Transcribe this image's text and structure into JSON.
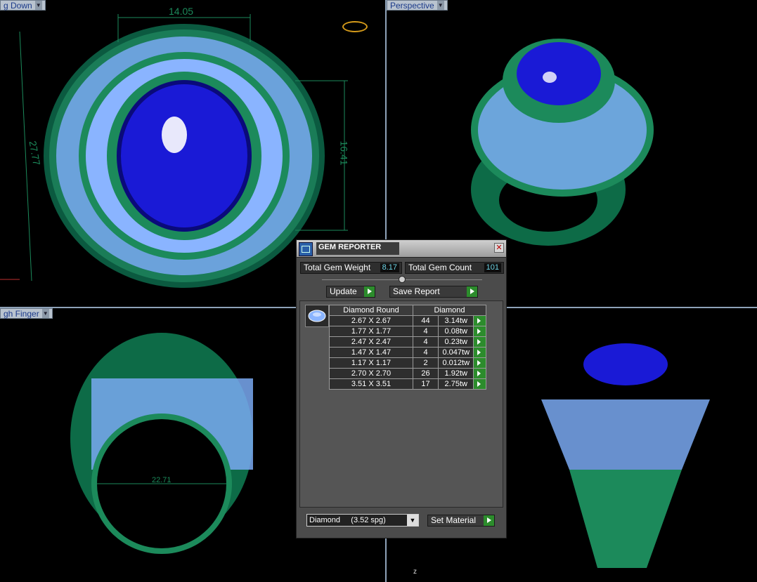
{
  "viewports": {
    "top_left": {
      "label": "g Down",
      "dim_width": "14.05",
      "dim_height_left": "27.77",
      "dim_height_right": "16.41"
    },
    "top_right": {
      "label": "Perspective"
    },
    "bottom_left": {
      "label": "gh Finger",
      "dim_diameter": "22.71"
    },
    "bottom_right": {
      "axis": "z"
    }
  },
  "colors": {
    "metal": "#1c8a5b",
    "gem_center": "#1a1ad6",
    "diamond": "#8ab4ff",
    "accent": "#2c8c2c"
  },
  "gem_reporter": {
    "title": "GEM REPORTER",
    "close_icon": "close-icon",
    "total_gem_weight_label": "Total Gem Weight",
    "total_gem_weight": "8.17",
    "total_gem_count_label": "Total Gem Count",
    "total_gem_count": "101",
    "update_label": "Update",
    "save_report_label": "Save Report",
    "table": {
      "col1": "Diamond Round",
      "col2": "Diamond",
      "rows": [
        {
          "size": "2.67 X 2.67",
          "count": "44",
          "weight": "3.14tw"
        },
        {
          "size": "1.77 X 1.77",
          "count": "4",
          "weight": "0.08tw"
        },
        {
          "size": "2.47 X 2.47",
          "count": "4",
          "weight": "0.23tw"
        },
        {
          "size": "1.47 X 1.47",
          "count": "4",
          "weight": "0.047tw"
        },
        {
          "size": "1.17 X 1.17",
          "count": "2",
          "weight": "0.012tw"
        },
        {
          "size": "2.70 X 2.70",
          "count": "26",
          "weight": "1.92tw"
        },
        {
          "size": "3.51 X 3.51",
          "count": "17",
          "weight": "2.75tw"
        }
      ]
    },
    "material_select": "Diamond     (3.52 spg)",
    "set_material_label": "Set Material"
  }
}
